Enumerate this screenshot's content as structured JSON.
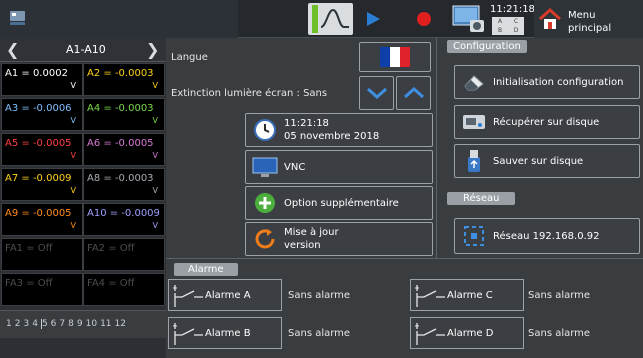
{
  "topbar": {
    "time": "11:21:18",
    "mini_grid": [
      "A",
      "C",
      "B",
      "D"
    ],
    "menu_label_line1": "Menu",
    "menu_label_line2": "principal",
    "colors": {
      "play": "#2a7fd4",
      "record": "#e02020",
      "scope_bg": "#d9dde0",
      "green_marker": "#6fbf2a"
    }
  },
  "channels": {
    "range_label": "A1-A10",
    "cells": [
      {
        "name": "A1",
        "value": "A1 = 0.0002",
        "unit": "V",
        "color": "#ffffff"
      },
      {
        "name": "A2",
        "value": "A2 = -0.0003",
        "unit": "V",
        "color": "#ffd21a"
      },
      {
        "name": "A3",
        "value": "A3 = -0.0006",
        "unit": "V",
        "color": "#7fbfff"
      },
      {
        "name": "A4",
        "value": "A4 = -0.0003",
        "unit": "V",
        "color": "#7ad94a"
      },
      {
        "name": "A5",
        "value": "A5 = -0.0005",
        "unit": "V",
        "color": "#ff4040"
      },
      {
        "name": "A6",
        "value": "A6 = -0.0005",
        "unit": "V",
        "color": "#d77ad7"
      },
      {
        "name": "A7",
        "value": "A7 = -0.0009",
        "unit": "V",
        "color": "#ffd21a"
      },
      {
        "name": "A8",
        "value": "A8 = -0.0003",
        "unit": "V",
        "color": "#a8adb2"
      },
      {
        "name": "A9",
        "value": "A9 = -0.0005",
        "unit": "V",
        "color": "#ff8c1a"
      },
      {
        "name": "A10",
        "value": "A10 = -0.0009",
        "unit": "V",
        "color": "#9f9fff"
      },
      {
        "name": "FA1",
        "value": "FA1 = Off",
        "unit": "",
        "color": "#4a4d50"
      },
      {
        "name": "FA2",
        "value": "FA2 = Off",
        "unit": "",
        "color": "#4a4d50"
      },
      {
        "name": "FA3",
        "value": "FA3 = Off",
        "unit": "",
        "color": "#4a4d50"
      },
      {
        "name": "FA4",
        "value": "FA4 = Off",
        "unit": "",
        "color": "#4a4d50"
      }
    ],
    "pages": [
      "1",
      "2",
      "3",
      "4",
      "5",
      "6",
      "7",
      "8",
      "9",
      "10",
      "11",
      "12"
    ]
  },
  "settings": {
    "language_label": "Langue",
    "screen_off_label": "Extinction lumière écran : Sans",
    "datetime_time": "11:21:18",
    "datetime_date": "05 novembre 2018",
    "vnc_label": "VNC",
    "option_label": "Option supplémentaire",
    "update_line1": "Mise à jour",
    "update_line2": "version"
  },
  "config": {
    "section_title": "Configuration",
    "init_label": "Initialisation configuration",
    "recover_label": "Récupérer sur disque",
    "save_label": "Sauver sur disque",
    "network_section": "Réseau",
    "network_label": "Réseau 192.168.0.92"
  },
  "alarms": {
    "section_title": "Alarme",
    "items": [
      {
        "label": "Alarme  A",
        "state": "Sans alarme"
      },
      {
        "label": "Alarme  C",
        "state": "Sans alarme"
      },
      {
        "label": "Alarme  B",
        "state": "Sans alarme"
      },
      {
        "label": "Alarme  D",
        "state": "Sans alarme"
      }
    ]
  }
}
